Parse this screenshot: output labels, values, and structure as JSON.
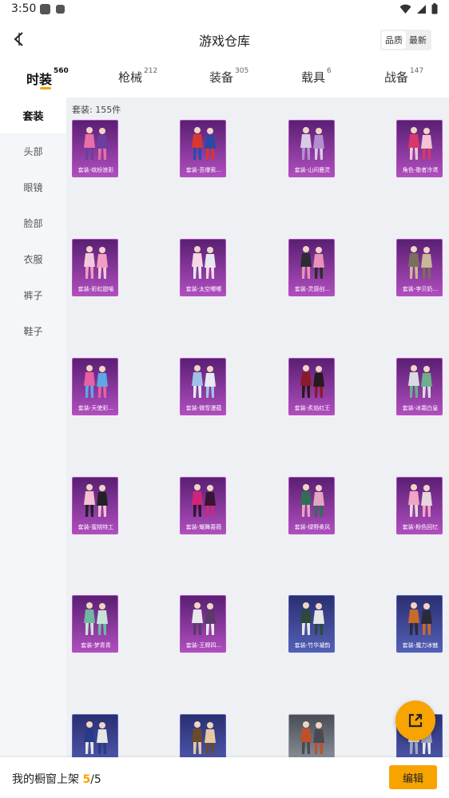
{
  "status": {
    "time": "3:50"
  },
  "header": {
    "title": "游戏仓库",
    "sort_options": [
      "品质",
      "最新"
    ],
    "sort_active": 0
  },
  "tabs": [
    {
      "label": "时装",
      "count": "560",
      "active": true
    },
    {
      "label": "枪械",
      "count": "212",
      "active": false
    },
    {
      "label": "装备",
      "count": "305",
      "active": false
    },
    {
      "label": "载具",
      "count": "6",
      "active": false
    },
    {
      "label": "战备",
      "count": "147",
      "active": false
    }
  ],
  "sidebar": {
    "items": [
      {
        "label": "套装",
        "active": true
      },
      {
        "label": "头部",
        "active": false
      },
      {
        "label": "眼镜",
        "active": false
      },
      {
        "label": "脸部",
        "active": false
      },
      {
        "label": "衣服",
        "active": false
      },
      {
        "label": "裤子",
        "active": false
      },
      {
        "label": "鞋子",
        "active": false
      }
    ]
  },
  "content": {
    "count_label": "套装: 155件",
    "items": [
      {
        "name": "套装-缤纷浪彩",
        "quality": "purple",
        "colors": [
          "#e86fa8",
          "#6b3fa0"
        ]
      },
      {
        "name": "套装-吾爆索...",
        "quality": "purple",
        "colors": [
          "#d9372f",
          "#2a4aa8"
        ]
      },
      {
        "name": "套装-山间鹿灵",
        "quality": "purple",
        "colors": [
          "#d8cbe6",
          "#b38fd1"
        ]
      },
      {
        "name": "角色-歌者冷鸢",
        "quality": "purple",
        "colors": [
          "#d7376a",
          "#f2c4d6"
        ]
      },
      {
        "name": "套装-彩虹甜喵",
        "quality": "purple",
        "colors": [
          "#f4c8dc",
          "#f19ec2"
        ]
      },
      {
        "name": "套装-太空嘟嘟",
        "quality": "purple",
        "colors": [
          "#f6d7e6",
          "#e8e8f0"
        ]
      },
      {
        "name": "套装-灵感创...",
        "quality": "purple",
        "colors": [
          "#2d2d33",
          "#e991b8"
        ]
      },
      {
        "name": "套装-李贝奶...",
        "quality": "purple",
        "colors": [
          "#7a6f5c",
          "#c9b79c"
        ]
      },
      {
        "name": "套装-天使彩...",
        "quality": "purple",
        "colors": [
          "#e95fa3",
          "#5aa9e6"
        ]
      },
      {
        "name": "套装-微雪漫蕴",
        "quality": "purple",
        "colors": [
          "#9fc1e8",
          "#e7e9f4"
        ]
      },
      {
        "name": "套装-炙焰红王",
        "quality": "purple",
        "colors": [
          "#8b1a2a",
          "#2a1a1f"
        ]
      },
      {
        "name": "套装-冰霜白皇",
        "quality": "purple",
        "colors": [
          "#d8dbe3",
          "#6fae8c"
        ]
      },
      {
        "name": "套装-蜜桃特工",
        "quality": "purple",
        "colors": [
          "#f3c1cf",
          "#222226"
        ]
      },
      {
        "name": "套装-耀舞蔷薇",
        "quality": "purple",
        "colors": [
          "#d0257a",
          "#3a1433"
        ]
      },
      {
        "name": "套装-绿野柔风",
        "quality": "purple",
        "colors": [
          "#2f6f57",
          "#e6a3c2"
        ]
      },
      {
        "name": "套装-粉色回忆",
        "quality": "purple",
        "colors": [
          "#f1a5c4",
          "#e7d6dd"
        ]
      },
      {
        "name": "套装-梦青青",
        "quality": "purple",
        "colors": [
          "#6fb7a3",
          "#c9e2d9"
        ]
      },
      {
        "name": "套装-王牌四...",
        "quality": "purple",
        "colors": [
          "#e8e8ec",
          "#5b3a6b"
        ]
      },
      {
        "name": "套装-竹华凝韵",
        "quality": "blue",
        "colors": [
          "#2b4a3b",
          "#e6e6e6"
        ]
      },
      {
        "name": "套装-魔力冰魅",
        "quality": "blue",
        "colors": [
          "#c96a2d",
          "#2a2a3a"
        ]
      },
      {
        "name": "",
        "quality": "blue",
        "colors": [
          "#2a3a8a",
          "#e6e6e6"
        ]
      },
      {
        "name": "",
        "quality": "blue",
        "colors": [
          "#6b4a2b",
          "#e6c8a0"
        ]
      },
      {
        "name": "",
        "quality": "grey",
        "colors": [
          "#c0502a",
          "#4a4a52"
        ]
      },
      {
        "name": "",
        "quality": "blue",
        "colors": [
          "#e6e6e6",
          "#a0a8c0"
        ]
      }
    ]
  },
  "qualities": {
    "purple": [
      "#b24fc0",
      "#5a1f73"
    ],
    "blue": [
      "#5561b8",
      "#2a2f70"
    ],
    "grey": [
      "#9aa0aa",
      "#4a4d55"
    ]
  },
  "bottom": {
    "label": "我的橱窗上架",
    "current": "5",
    "separator": "/",
    "total": "5",
    "edit_label": "编辑"
  }
}
